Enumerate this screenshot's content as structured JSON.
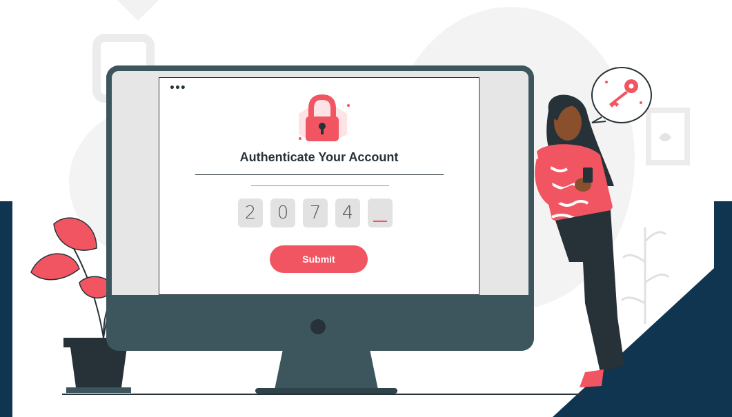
{
  "window": {
    "menu_dots": "•••"
  },
  "auth": {
    "title": "Authenticate Your Account",
    "code_digits": [
      "2",
      "0",
      "7",
      "4",
      ""
    ],
    "submit_label": "Submit"
  },
  "icons": {
    "lock": "padlock-icon",
    "key": "key-icon",
    "phone": "smartphone-icon"
  },
  "colors": {
    "accent": "#f25562",
    "navy": "#0f3551",
    "monitor": "#3d565e",
    "code_box": "#e2e2e2"
  }
}
